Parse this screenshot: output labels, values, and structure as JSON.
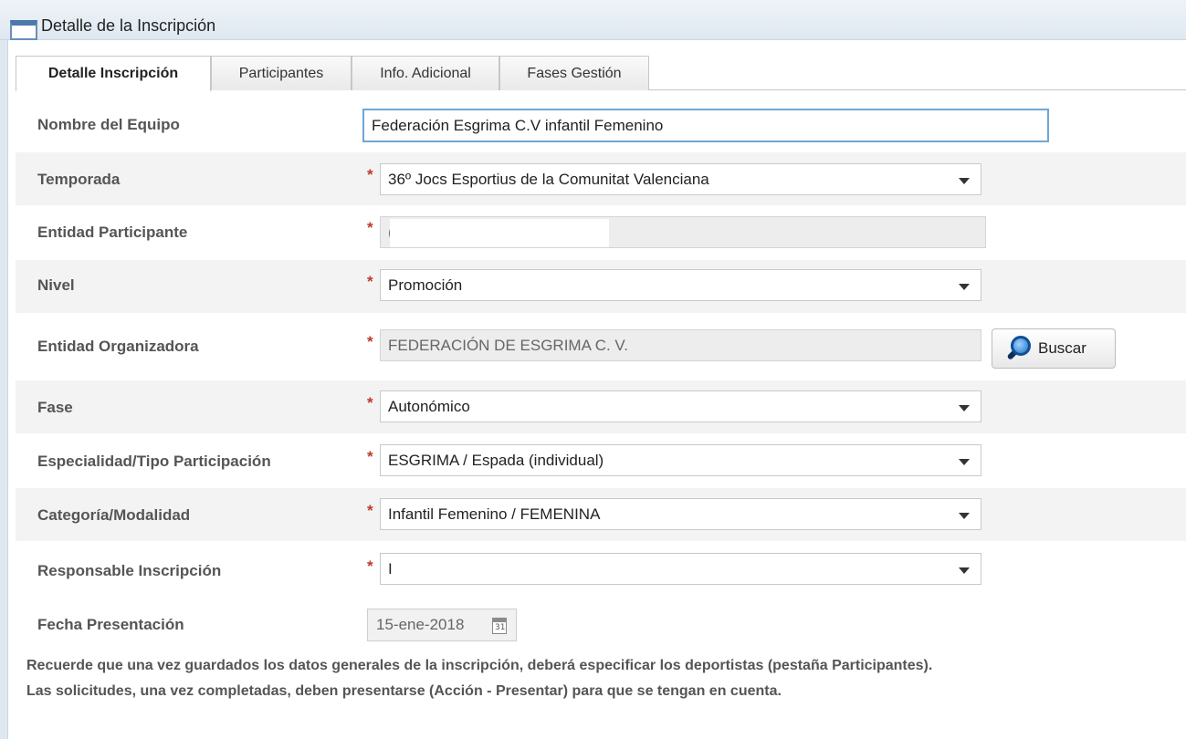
{
  "window": {
    "title": "Detalle de la Inscripción"
  },
  "tabs": [
    {
      "label": "Detalle Inscripción",
      "active": true
    },
    {
      "label": "Participantes",
      "active": false
    },
    {
      "label": "Info. Adicional",
      "active": false
    },
    {
      "label": "Fases Gestión",
      "active": false
    }
  ],
  "form": {
    "required_mark": "*",
    "nombre_equipo": {
      "label": "Nombre del Equipo",
      "value": "Federación Esgrima C.V infantil Femenino"
    },
    "temporada": {
      "label": "Temporada",
      "value": "36º Jocs Esportius de la Comunitat Valenciana"
    },
    "entidad_participante": {
      "label": "Entidad Participante",
      "value": "("
    },
    "nivel": {
      "label": "Nivel",
      "value": "Promoción"
    },
    "entidad_organizadora": {
      "label": "Entidad Organizadora",
      "value": "FEDERACIÓN DE ESGRIMA C. V.",
      "button_label": "Buscar"
    },
    "fase": {
      "label": "Fase",
      "value": "Autonómico"
    },
    "especialidad": {
      "label": "Especialidad/Tipo Participación",
      "value": "ESGRIMA / Espada (individual)"
    },
    "categoria": {
      "label": "Categoría/Modalidad",
      "value": "Infantil Femenino / FEMENINA"
    },
    "responsable": {
      "label": "Responsable Inscripción",
      "value": "I"
    },
    "fecha": {
      "label": "Fecha Presentación",
      "value": "15-ene-2018",
      "calendar_day": "31"
    }
  },
  "notes": [
    "Recuerde que una vez guardados los datos generales de la inscripción, deberá especificar los deportistas (pestaña Participantes).",
    "Las solicitudes, una vez completadas, deben presentarse (Acción - Presentar) para que se tengan en cuenta."
  ]
}
